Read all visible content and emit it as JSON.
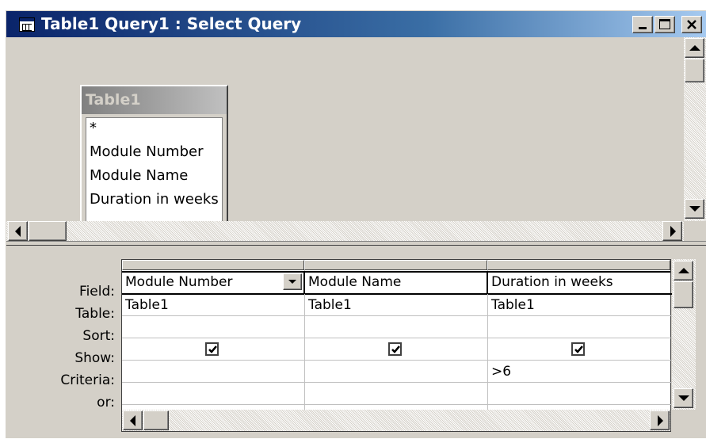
{
  "window": {
    "title": "Table1 Query1 : Select Query"
  },
  "table_box": {
    "title": "Table1",
    "fields": [
      "*",
      "Module Number",
      "Module Name",
      "Duration in weeks"
    ]
  },
  "grid": {
    "row_labels": [
      "Field:",
      "Table:",
      "Sort:",
      "Show:",
      "Criteria:",
      "or:"
    ],
    "columns": [
      {
        "field": "Module Number",
        "table": "Table1",
        "sort": "",
        "show": true,
        "criteria": "",
        "or": ""
      },
      {
        "field": "Module Name",
        "table": "Table1",
        "sort": "",
        "show": true,
        "criteria": "",
        "or": ""
      },
      {
        "field": "Duration in weeks",
        "table": "Table1",
        "sort": "",
        "show": true,
        "criteria": ">6",
        "or": ""
      }
    ]
  },
  "icons": {
    "app": "datasheet-icon",
    "minimize": "minimize-icon",
    "maximize": "maximize-icon",
    "close": "close-icon"
  }
}
